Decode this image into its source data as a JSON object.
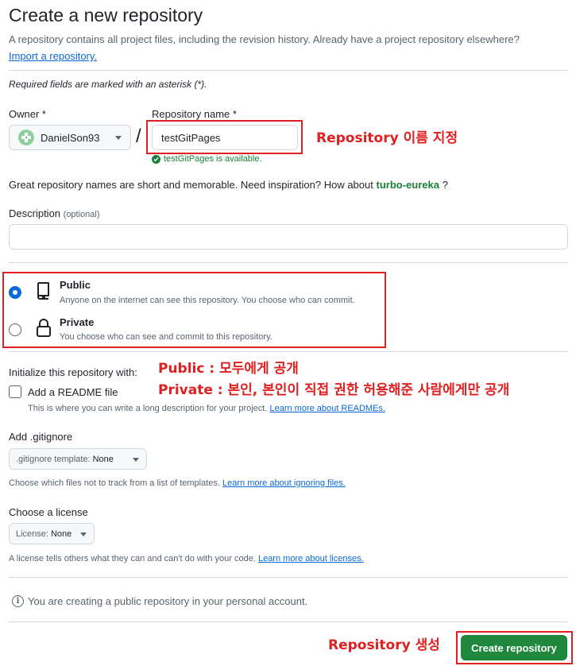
{
  "header": {
    "title": "Create a new repository",
    "subtitle": "A repository contains all project files, including the revision history. Already have a project repository elsewhere?",
    "import_link": "Import a repository."
  },
  "required_note": "Required fields are marked with an asterisk (*).",
  "owner": {
    "label": "Owner *",
    "value": "DanielSon93"
  },
  "repo_name": {
    "label": "Repository name *",
    "value": "testGitPages",
    "availability": "testGitPages is available."
  },
  "inspiration": {
    "text": "Great repository names are short and memorable. Need inspiration? How about",
    "suggestion": "turbo-eureka",
    "suffix": "?"
  },
  "description": {
    "label": "Description",
    "optional": "(optional)",
    "value": ""
  },
  "visibility": {
    "selected": "public",
    "public": {
      "title": "Public",
      "desc": "Anyone on the internet can see this repository. You choose who can commit."
    },
    "private": {
      "title": "Private",
      "desc": "You choose who can see and commit to this repository."
    }
  },
  "initialize": {
    "heading": "Initialize this repository with:",
    "readme_label": "Add a README file",
    "readme_desc": "This is where you can write a long description for your project.",
    "readme_link": "Learn more about READMEs."
  },
  "gitignore": {
    "heading": "Add .gitignore",
    "dropdown_prefix": ".gitignore template:",
    "dropdown_value": "None",
    "desc": "Choose which files not to track from a list of templates.",
    "link": "Learn more about ignoring files."
  },
  "license": {
    "heading": "Choose a license",
    "dropdown_prefix": "License:",
    "dropdown_value": "None",
    "desc": "A license tells others what they can and can't do with your code.",
    "link": "Learn more about licenses."
  },
  "info_note": "You are creating a public repository in your personal account.",
  "create_button": "Create repository",
  "annotations": {
    "repo_name": "Repository 이름 지정",
    "public": "Public : 모두에게 공개",
    "private": "Private : 본인, 본인이 직접 권한 허용해준 사람에게만 공개",
    "create": "Repository 생성"
  },
  "colors": {
    "primary_button": "#1f883d",
    "link": "#0969da",
    "success": "#1a7f37",
    "annotation_red": "#e02020"
  }
}
